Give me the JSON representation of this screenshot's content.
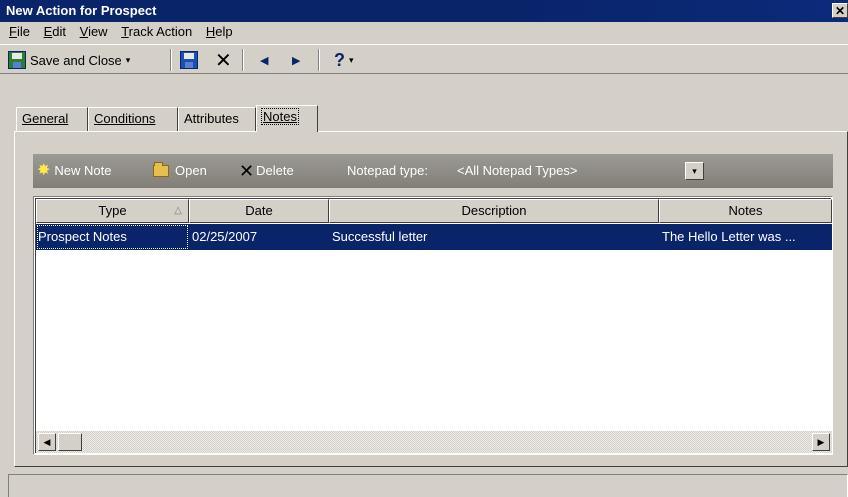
{
  "window": {
    "title": "New Action for Prospect",
    "close_glyph": "✕"
  },
  "menu": [
    "File",
    "Edit",
    "View",
    "Track Action",
    "Help"
  ],
  "toolbar": {
    "save_close_label": "Save and Close",
    "dropdown_glyph": "▾",
    "delete_glyph": "✕",
    "prev_glyph": "◀",
    "next_glyph": "▶",
    "help_glyph": "?"
  },
  "tabs": [
    {
      "label": "General",
      "active": false
    },
    {
      "label": "Conditions",
      "active": false
    },
    {
      "label": "Attributes",
      "active": false
    },
    {
      "label": "Notes",
      "active": true
    }
  ],
  "notes_toolbar": {
    "new_note": "New Note",
    "open": "Open",
    "delete": "Delete",
    "notepad_type_label": "Notepad type:",
    "notepad_type_value": "<All Notepad Types>",
    "dropdown_glyph": "▾"
  },
  "grid": {
    "columns": [
      "Type",
      "Date",
      "Description",
      "Notes"
    ],
    "sort_glyph": "△",
    "rows": [
      {
        "type": "Prospect Notes",
        "date": "02/25/2007",
        "description": "Successful letter",
        "notes": "The Hello Letter was ..."
      }
    ]
  },
  "scrollbar": {
    "left_glyph": "◀",
    "right_glyph": "▶"
  },
  "colors": {
    "title_bar": "#0a246a",
    "selection": "#0a246a",
    "chrome": "#d4d0c8"
  }
}
